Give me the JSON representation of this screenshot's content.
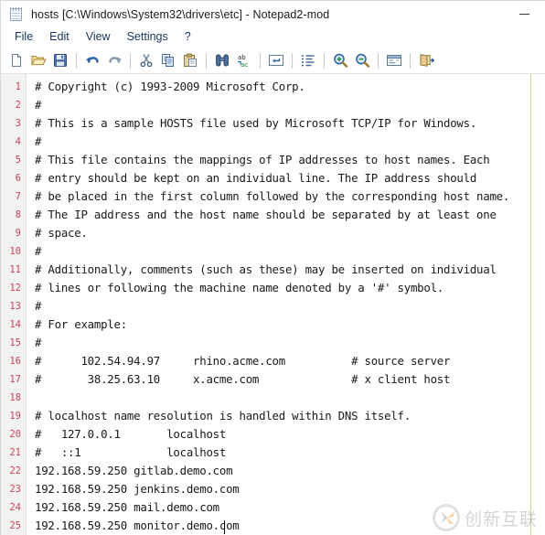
{
  "window": {
    "title": "hosts [C:\\Windows\\System32\\drivers\\etc] - Notepad2-mod",
    "icon": "notepad-icon",
    "minimize_label": "—"
  },
  "menubar": {
    "items": [
      {
        "label": "File"
      },
      {
        "label": "Edit"
      },
      {
        "label": "View"
      },
      {
        "label": "Settings"
      },
      {
        "label": "?"
      }
    ]
  },
  "toolbar": {
    "buttons": [
      {
        "name": "new-file-icon",
        "tooltip": "New"
      },
      {
        "name": "open-file-icon",
        "tooltip": "Open"
      },
      {
        "name": "save-file-icon",
        "tooltip": "Save"
      },
      {
        "name": "undo-icon",
        "tooltip": "Undo"
      },
      {
        "name": "redo-icon",
        "tooltip": "Redo"
      },
      {
        "name": "cut-icon",
        "tooltip": "Cut"
      },
      {
        "name": "copy-icon",
        "tooltip": "Copy"
      },
      {
        "name": "paste-icon",
        "tooltip": "Paste"
      },
      {
        "name": "find-icon",
        "tooltip": "Find"
      },
      {
        "name": "replace-icon",
        "tooltip": "Replace"
      },
      {
        "name": "word-wrap-icon",
        "tooltip": "Word Wrap"
      },
      {
        "name": "line-numbers-icon",
        "tooltip": "Show Line Numbers"
      },
      {
        "name": "zoom-in-icon",
        "tooltip": "Zoom In"
      },
      {
        "name": "zoom-out-icon",
        "tooltip": "Zoom Out"
      },
      {
        "name": "scheme-icon",
        "tooltip": "Scheme"
      },
      {
        "name": "exit-icon",
        "tooltip": "Exit"
      }
    ]
  },
  "editor": {
    "line_count": 25,
    "caret": {
      "line": 25,
      "column": 29
    },
    "lines": [
      {
        "n": "1",
        "text": "# Copyright (c) 1993-2009 Microsoft Corp."
      },
      {
        "n": "2",
        "text": "#"
      },
      {
        "n": "3",
        "text": "# This is a sample HOSTS file used by Microsoft TCP/IP for Windows."
      },
      {
        "n": "4",
        "text": "#"
      },
      {
        "n": "5",
        "text": "# This file contains the mappings of IP addresses to host names. Each"
      },
      {
        "n": "6",
        "text": "# entry should be kept on an individual line. The IP address should"
      },
      {
        "n": "7",
        "text": "# be placed in the first column followed by the corresponding host name."
      },
      {
        "n": "8",
        "text": "# The IP address and the host name should be separated by at least one"
      },
      {
        "n": "9",
        "text": "# space."
      },
      {
        "n": "10",
        "text": "#"
      },
      {
        "n": "11",
        "text": "# Additionally, comments (such as these) may be inserted on individual"
      },
      {
        "n": "12",
        "text": "# lines or following the machine name denoted by a '#' symbol."
      },
      {
        "n": "13",
        "text": "#"
      },
      {
        "n": "14",
        "text": "# For example:"
      },
      {
        "n": "15",
        "text": "#"
      },
      {
        "n": "16",
        "text": "#      102.54.94.97     rhino.acme.com          # source server"
      },
      {
        "n": "17",
        "text": "#       38.25.63.10     x.acme.com              # x client host"
      },
      {
        "n": "18",
        "text": ""
      },
      {
        "n": "19",
        "text": "# localhost name resolution is handled within DNS itself."
      },
      {
        "n": "20",
        "text": "#   127.0.0.1       localhost"
      },
      {
        "n": "21",
        "text": "#   ::1             localhost"
      },
      {
        "n": "22",
        "text": "192.168.59.250 gitlab.demo.com"
      },
      {
        "n": "23",
        "text": "192.168.59.250 jenkins.demo.com"
      },
      {
        "n": "24",
        "text": "192.168.59.250 mail.demo.com"
      },
      {
        "n": "25",
        "text": "192.168.59.250 monitor.demo.com"
      }
    ]
  },
  "watermark": {
    "text": "创新互联",
    "mark": "cx-logo-icon"
  },
  "colors": {
    "line_number": "#c8455c",
    "code_text": "#1a1a1a",
    "menu_text": "#17375e",
    "gutter_bg": "#f2f2f2",
    "editor_bg": "#ffffff",
    "margin_line": "#d9d08a"
  }
}
